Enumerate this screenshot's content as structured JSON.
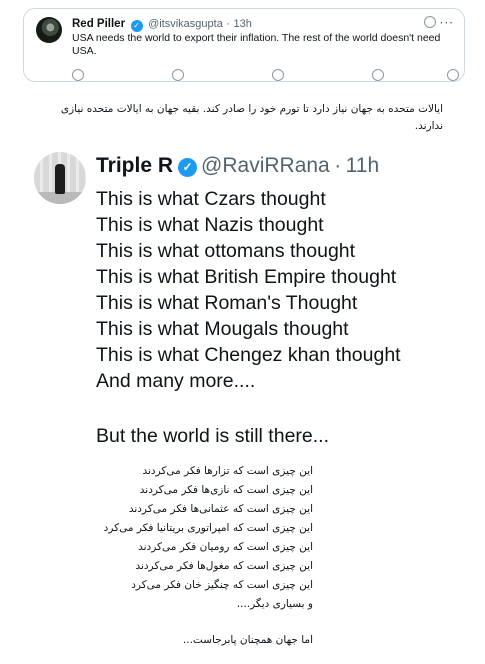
{
  "quoted_tweet": {
    "author_name": "Red Piller",
    "handle": "@itsvikasgupta",
    "separator": "·",
    "time": "13h",
    "text": "USA needs the world to export their inflation. The rest of the world doesn't need USA.",
    "more_glyph": "···",
    "verified_glyph": "✓"
  },
  "translation_top": "ایالات متحده به جهان نیاز دارد تا تورم خود را صادر کند. بقیه جهان به ایالات متحده نیازی ندارند.",
  "embedded_tweet": {
    "author_name": "Triple R",
    "verified_glyph": "✓",
    "handle": "@RaviRRana",
    "separator": "·",
    "time": "11h",
    "lines": [
      "This is what Czars thought",
      "This is what Nazis thought",
      "This is what ottomans thought",
      "This is what British Empire thought",
      "This is what Roman's Thought",
      "This is what Mougals thought",
      "This is what Chengez khan thought",
      "And many more...."
    ],
    "closing": "But the world is still there..."
  },
  "translation_lines": [
    "این چیزی است که تزارها فکر می‌کردند",
    "این چیزی است که نازی‌ها فکر می‌کردند",
    "این چیزی است که عثمانی‌ها فکر می‌کردند",
    "این چیزی است که امپراتوری بریتانیا فکر می‌کرد",
    "این چیزی است که رومیان فکر می‌کردند",
    "این چیزی است که مغول‌ها فکر می‌کردند",
    "این چیزی است که چنگیز خان فکر می‌کرد",
    "و بسیاری دیگر...."
  ],
  "translation_closing": "اما جهان همچنان پابرجاست...",
  "colors": {
    "link_blue": "#1d9bf0",
    "muted": "#536471",
    "border": "#cfd9de"
  }
}
